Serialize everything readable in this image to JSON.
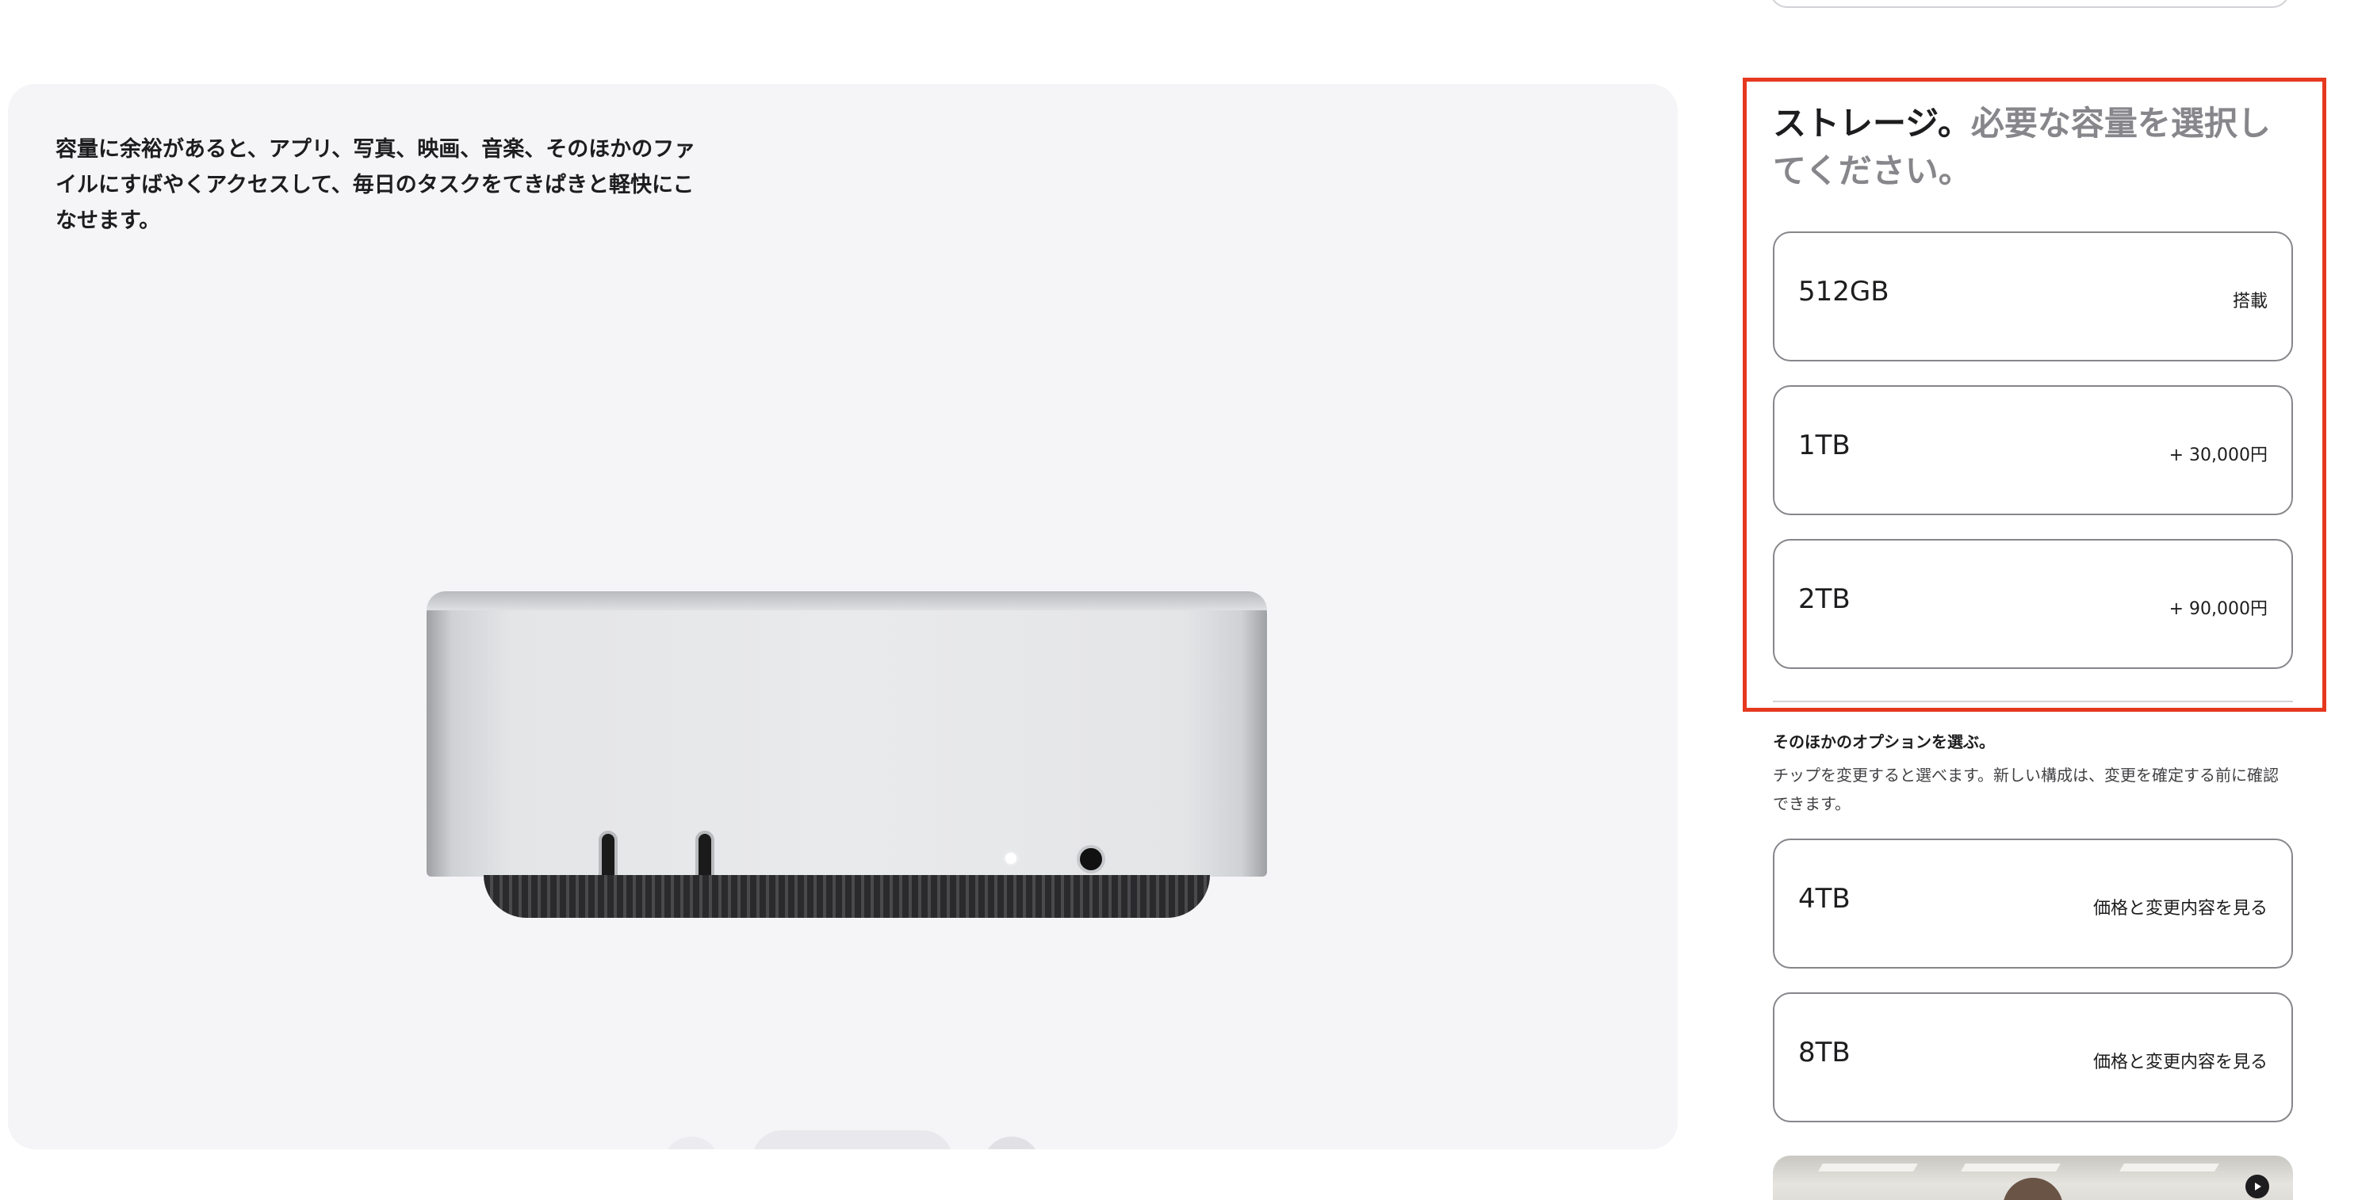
{
  "gallery": {
    "caption": "容量に余裕があると、アプリ、写真、映画、音楽、そのほかのファイルにすばやくアクセスして、毎日のタスクをてきぱきと軽快にこなせます。",
    "dots_total": 4,
    "active_dot": 1
  },
  "storage": {
    "title_bold": "ストレージ。",
    "title_light": "必要な容量を選択してください。",
    "options": [
      {
        "size": "512GB",
        "price": "搭載"
      },
      {
        "size": "1TB",
        "price": "+ 30,000円"
      },
      {
        "size": "2TB",
        "price": "+ 90,000円"
      }
    ]
  },
  "more_options": {
    "title": "そのほかのオプションを選ぶ。",
    "description": "チップを変更すると選べます。新しい構成は、変更を確定する前に確認できます。",
    "options": [
      {
        "size": "4TB",
        "price": "価格と変更内容を見る"
      },
      {
        "size": "8TB",
        "price": "価格と変更内容を見る"
      }
    ]
  },
  "colors": {
    "highlight": "#e5391f",
    "panel_bg": "#f5f5f7",
    "border": "#86868b"
  },
  "icons": {
    "prev": "chevron-left-icon",
    "next": "chevron-right-icon",
    "play": "play-icon"
  }
}
